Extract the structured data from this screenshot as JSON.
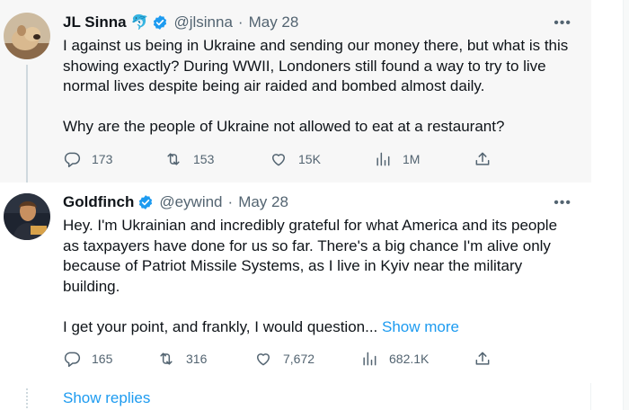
{
  "tweets": [
    {
      "name": "JL Sinna",
      "emoji": "🐬",
      "handle": "@jlsinna",
      "sep": "·",
      "date": "May 28",
      "more": "•••",
      "paragraphs": [
        "I against us being in Ukraine and sending our money there, but what is this showing exactly? During WWII, Londoners still found a way to try to live normal lives despite being air raided and bombed almost daily.",
        "Why are the people of Ukraine not allowed to eat at a restaurant?"
      ],
      "replies": "173",
      "reposts": "153",
      "likes": "15K",
      "views": "1M"
    },
    {
      "name": "Goldfinch",
      "handle": "@eywind",
      "sep": "·",
      "date": "May 28",
      "more": "•••",
      "paragraphs": [
        "Hey. I'm Ukrainian and incredibly grateful for what America and its people as taxpayers have done for us so far. There's a big chance I'm alive only because of Patriot Missile Systems, as I live in Kyiv near the military building.",
        "I get your point, and frankly, I would question..."
      ],
      "show_more": "Show more",
      "replies": "165",
      "reposts": "316",
      "likes": "7,672",
      "views": "682.1K"
    }
  ],
  "show_replies": "Show replies",
  "colors": {
    "accent": "#1d9bf0",
    "muted": "#536471",
    "verified": "#1d9bf0",
    "text": "#0f1419"
  }
}
